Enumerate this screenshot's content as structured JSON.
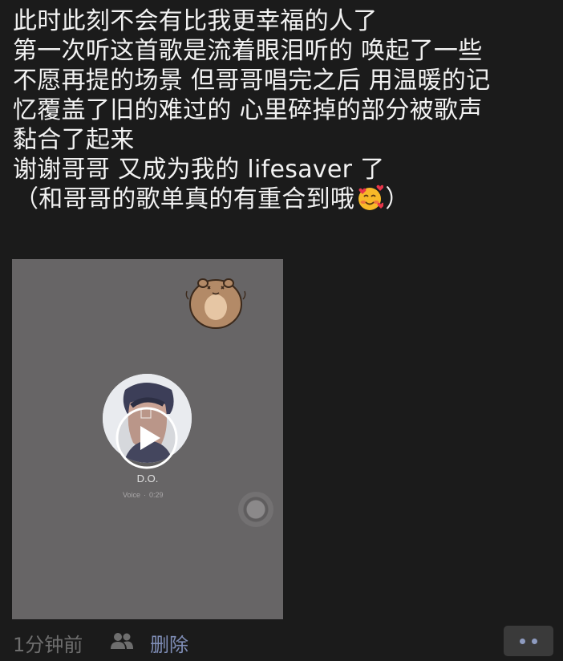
{
  "post": {
    "lines": [
      "此时此刻不会有比我更幸福的人了",
      "第一次听这首歌是流着眼泪听的 唤起了一些",
      "不愿再提的场景 但哥哥唱完之后 用温暖的记",
      "忆覆盖了旧的难过的 心里碎掉的部分被歌声",
      "黏合了起来",
      "谢谢哥哥 又成为我的 lifesaver 了"
    ],
    "last_line_before_emoji": "（和哥哥的歌单真的有重合到哦",
    "last_line_after_emoji": "）",
    "emoji": "smiling-face-with-hearts-icon"
  },
  "media": {
    "voice_name": "D.O.",
    "voice_label": "Voice",
    "voice_sep": "·",
    "voice_duration": "0:29",
    "background_color": "#676566"
  },
  "footer": {
    "timestamp": "1分钟前",
    "delete_label": "删除",
    "link_color": "#7f8db6"
  }
}
